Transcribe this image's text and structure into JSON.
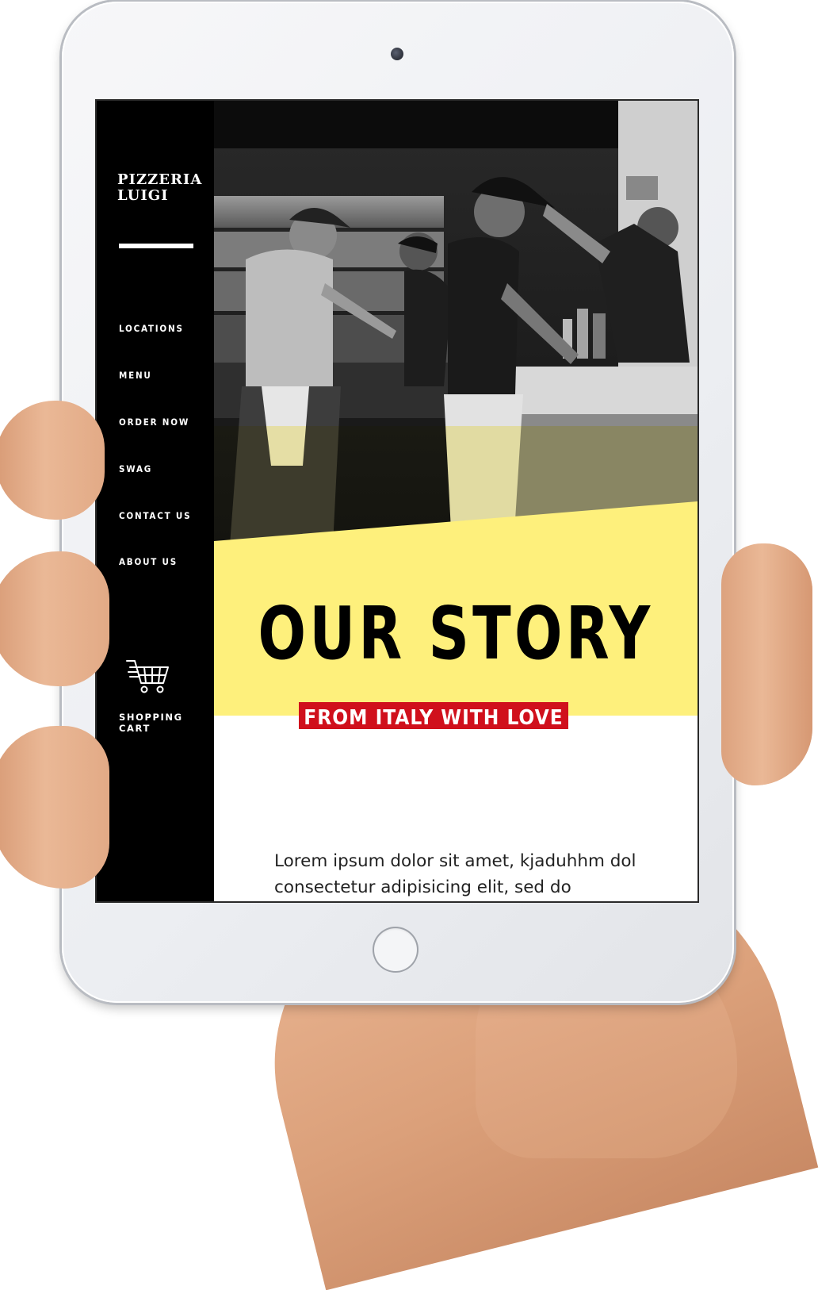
{
  "brand": {
    "name": "PIZZERIA LUIGI"
  },
  "nav": {
    "items": [
      {
        "label": "LOCATIONS"
      },
      {
        "label": "MENU"
      },
      {
        "label": "ORDER NOW"
      },
      {
        "label": "SWAG"
      },
      {
        "label": "CONTACT US"
      },
      {
        "label": "ABOUT US"
      }
    ],
    "cart_label": "SHOPPING CART",
    "cart_icon": "shopping-cart-icon"
  },
  "hero": {
    "title": "OUR STORY",
    "tagline": "FROM ITALY WITH LOVE"
  },
  "content": {
    "body": "Lorem ipsum dolor sit amet, kjaduhhm dol consectetur adipisicing elit, sed do eiusmod tempor incididunt ut labore et"
  },
  "colors": {
    "sidebar": "#000000",
    "accent_yellow": "#fef07c",
    "accent_red": "#d0101c",
    "text": "#222222"
  }
}
